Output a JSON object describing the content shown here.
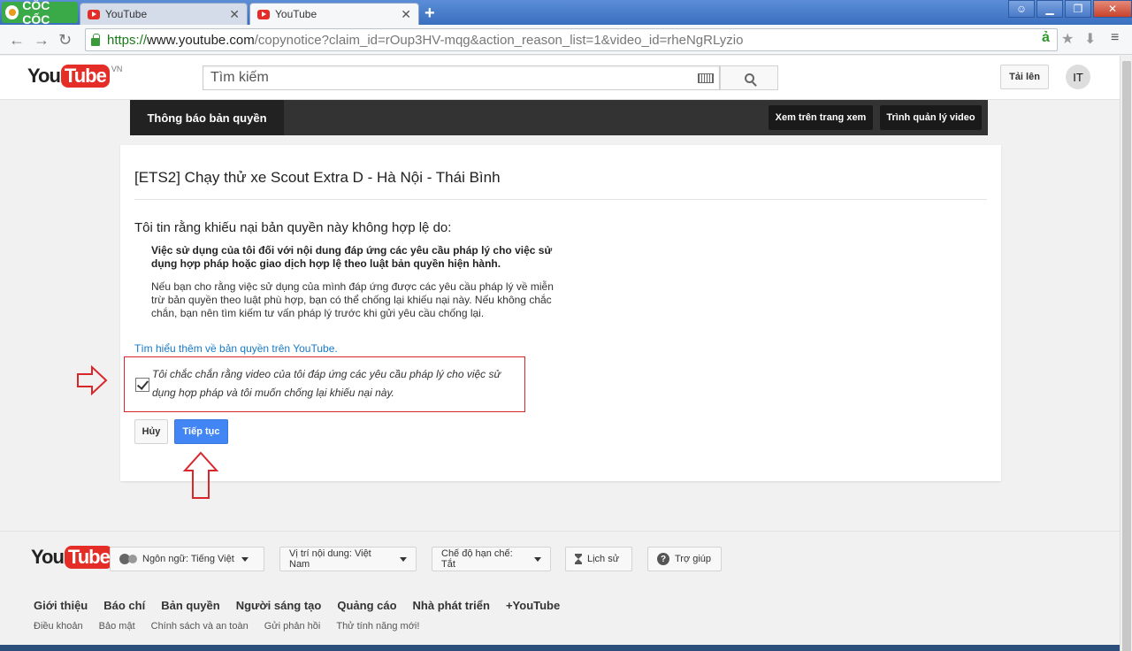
{
  "browser": {
    "brand": "CỐC CỐC",
    "tabs": [
      {
        "title": "YouTube",
        "active": false
      },
      {
        "title": "YouTube",
        "active": true
      }
    ],
    "new_tab_symbol": "+",
    "url": {
      "scheme": "https://",
      "host": "www.youtube.com",
      "path": "/copynotice?claim_id=rOup3HV-mqg&action_reason_list=1&video_id=rheNgRLyzio"
    },
    "accent": "#3a6fc0"
  },
  "header": {
    "logo_you": "You",
    "logo_tube": "Tube",
    "logo_region": "VN",
    "search_placeholder": "Tìm kiếm",
    "upload_label": "Tải lên",
    "avatar_text": "IT"
  },
  "nav": {
    "title": "Thông báo bản quyền",
    "watch_page": "Xem trên trang xem",
    "video_manager": "Trình quản lý video"
  },
  "main": {
    "video_title": "[ETS2] Chạy thử xe Scout Extra D - Hà Nội - Thái Bình",
    "lead": "Tôi tin rằng khiếu nại bản quyền này không hợp lệ do:",
    "reason_bold": "Việc sử dụng của tôi đối với nội dung đáp ứng các yêu cầu pháp lý cho việc sử dụng hợp pháp hoặc giao dịch hợp lệ theo luật bản quyền hiện hành.",
    "reason_detail": "Nếu bạn cho rằng việc sử dụng của mình đáp ứng được các yêu cầu pháp lý về miễn trừ bản quyền theo luật phù hợp, bạn có thể chống lại khiếu nại này. Nếu không chắc chắn, bạn nên tìm kiếm tư vấn pháp lý trước khi gửi yêu cầu chống lại.",
    "learn_more": "Tìm hiểu thêm về bản quyền trên YouTube.",
    "confirm_text": "Tôi chắc chắn rằng video của tôi đáp ứng các yêu cầu pháp lý cho việc sử dụng hợp pháp và tôi muốn chống lại khiếu nại này.",
    "confirm_checked": true,
    "cancel_label": "Hủy",
    "continue_label": "Tiếp tục",
    "highlight_color": "#d9262b"
  },
  "footer": {
    "language": "Ngôn ngữ: Tiếng Việt",
    "location": "Vị trí nội dung: Việt Nam",
    "restricted": "Chế độ hạn chế: Tắt",
    "history": "Lịch sử",
    "help": "Trợ giúp",
    "links": [
      "Giới thiệu",
      "Báo chí",
      "Bản quyền",
      "Người sáng tạo",
      "Quảng cáo",
      "Nhà phát triển",
      "+YouTube"
    ],
    "links2": [
      "Điều khoản",
      "Bảo mật",
      "Chính sách và an toàn",
      "Gửi phản hồi",
      "Thử tính năng mới!"
    ]
  }
}
